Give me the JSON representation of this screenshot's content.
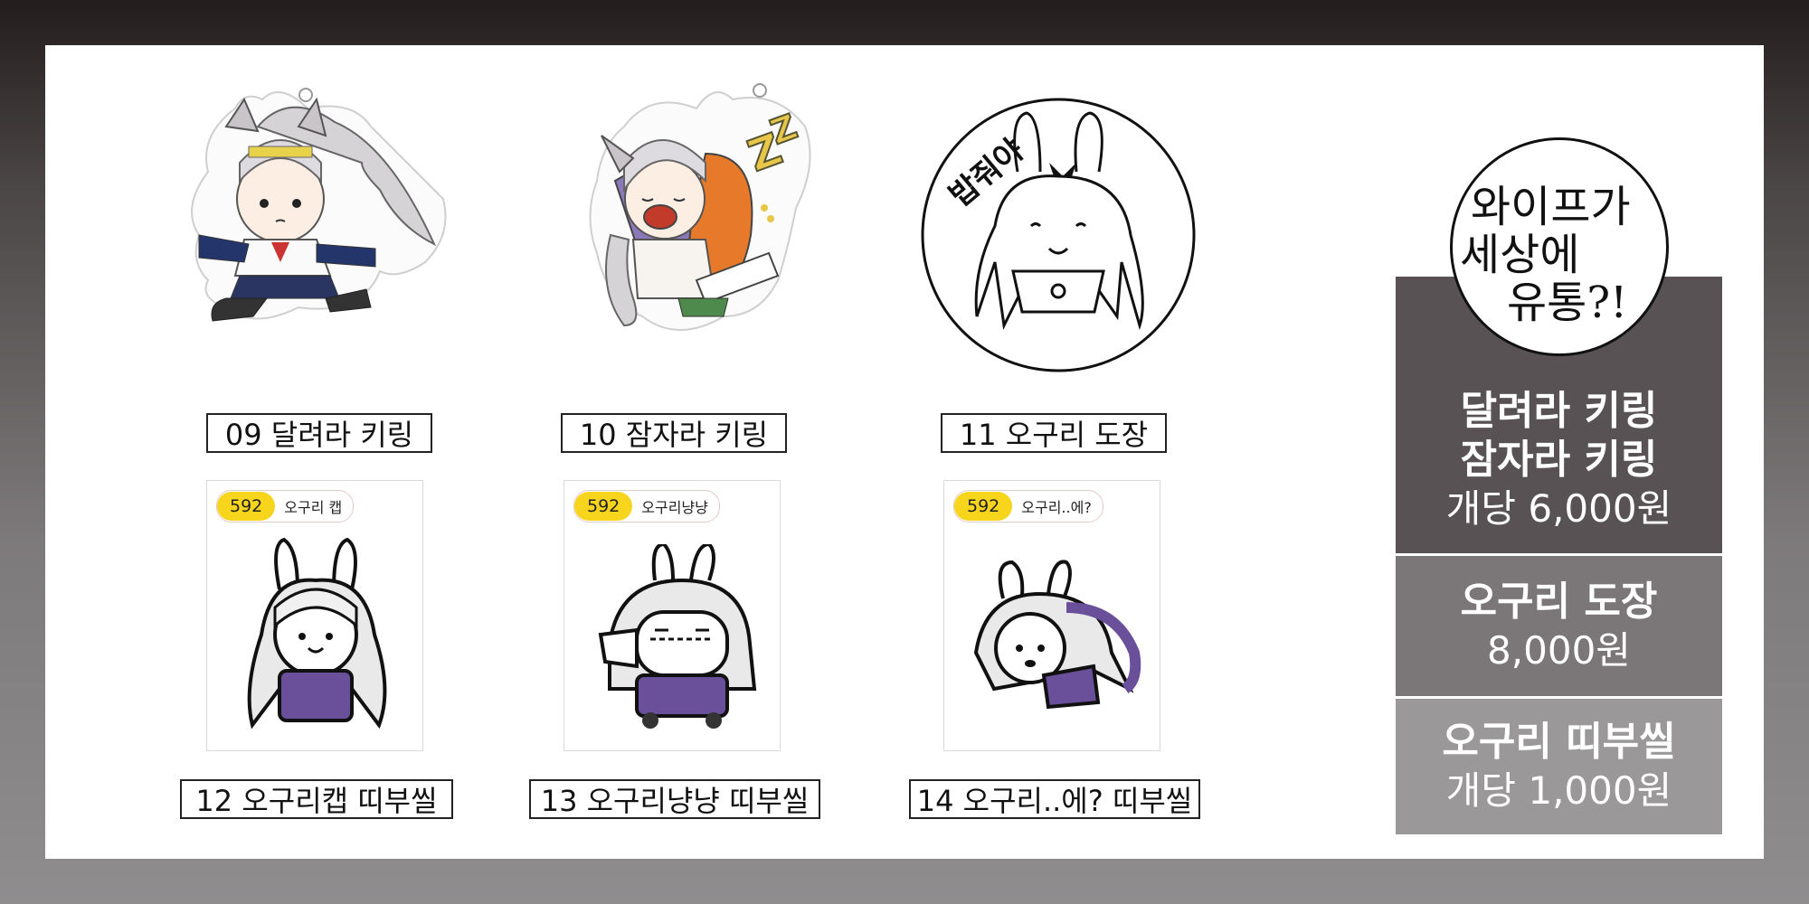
{
  "products": [
    {
      "label": "09 달려라 키링"
    },
    {
      "label": "10 잠자라 키링"
    },
    {
      "label": "11 오구리 도장"
    },
    {
      "label": "12 오구리캡 띠부씰",
      "tag_num": "592",
      "tag_text": "오구리 캡"
    },
    {
      "label": "13 오구리냥냥 띠부씰",
      "tag_num": "592",
      "tag_text": "오구리냥냥"
    },
    {
      "label": "14 오구리..에? 띠부씰",
      "tag_num": "592",
      "tag_text": "오구리..에?"
    }
  ],
  "stamp_text": "밥줘야",
  "badge": {
    "line1": "와이프가",
    "line2": "세상에",
    "line3": "유통?!"
  },
  "prices": [
    {
      "name1": "달려라 키링",
      "name2": "잠자라 키링",
      "price": "개당 6,000원"
    },
    {
      "name1": "오구리 도장",
      "price": "8,000원"
    },
    {
      "name1": "오구리 띠부씰",
      "price": "개당 1,000원"
    }
  ],
  "colors": {
    "tag_yellow": "#f7d51d",
    "box1": "#585254",
    "box2": "#7b7778",
    "box3": "#9a9899"
  }
}
